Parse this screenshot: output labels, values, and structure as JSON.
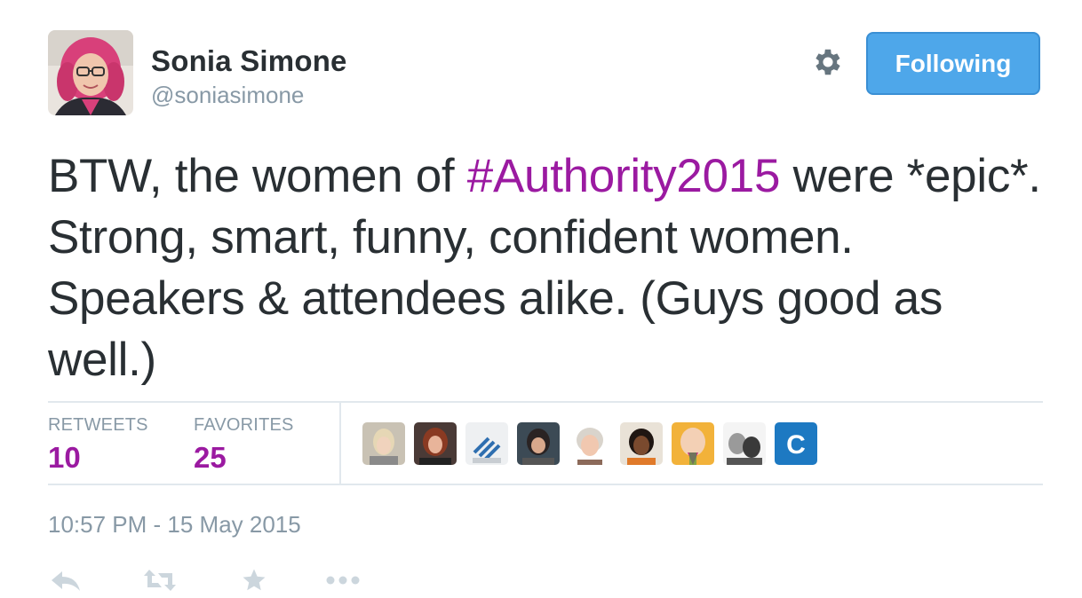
{
  "user": {
    "display_name": "Sonia Simone",
    "handle": "@soniasimone",
    "follow_label": "Following"
  },
  "tweet": {
    "text_before": "BTW, the women of ",
    "hashtag": "#Authority2015",
    "text_after": " were *epic*. Strong, smart, funny, confident women. Speakers & attendees alike. (Guys good as well.)"
  },
  "stats": {
    "retweets_label": "RETWEETS",
    "retweets_count": "10",
    "favorites_label": "FAVORITES",
    "favorites_count": "25"
  },
  "favoriters": [
    {
      "name": "favoriter-1"
    },
    {
      "name": "favoriter-2"
    },
    {
      "name": "favoriter-3"
    },
    {
      "name": "favoriter-4"
    },
    {
      "name": "favoriter-5"
    },
    {
      "name": "favoriter-6"
    },
    {
      "name": "favoriter-7"
    },
    {
      "name": "favoriter-8"
    },
    {
      "name": "favoriter-9",
      "letter": "C"
    }
  ],
  "timestamp": "10:57 PM - 15 May 2015",
  "actions": {
    "reply_icon": "reply-icon",
    "retweet_icon": "retweet-icon",
    "favorite_icon": "star-icon",
    "more_icon": "more-icon"
  },
  "colors": {
    "accent": "#9b1aa1",
    "follow_button": "#4ea7ea",
    "muted": "#8899a6"
  }
}
